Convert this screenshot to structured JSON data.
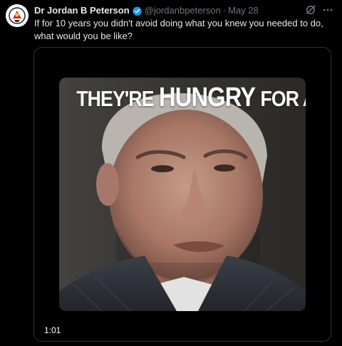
{
  "tweet": {
    "author": {
      "display_name": "Dr Jordan B Peterson",
      "verified_icon": "verified-badge-icon",
      "handle": "@jordanbpeterson",
      "separator": "·",
      "timestamp": "May 28"
    },
    "text_lines": [
      "If for 10 years you didn't avoid doing what you knew you needed to do,",
      "what would you be like?"
    ],
    "actions": {
      "grok_icon": "grok-icon",
      "more_icon": "more-icon"
    },
    "media": {
      "caption": {
        "part1": "THEY'RE",
        "part2": "HUNGRY",
        "part3": "FOR A"
      },
      "duration": "1:01"
    }
  },
  "colors": {
    "background": "#000000",
    "text_primary": "#e7e9ea",
    "text_secondary": "#71767b",
    "verified_blue": "#1d9bf0",
    "card_border": "#2f3336"
  }
}
